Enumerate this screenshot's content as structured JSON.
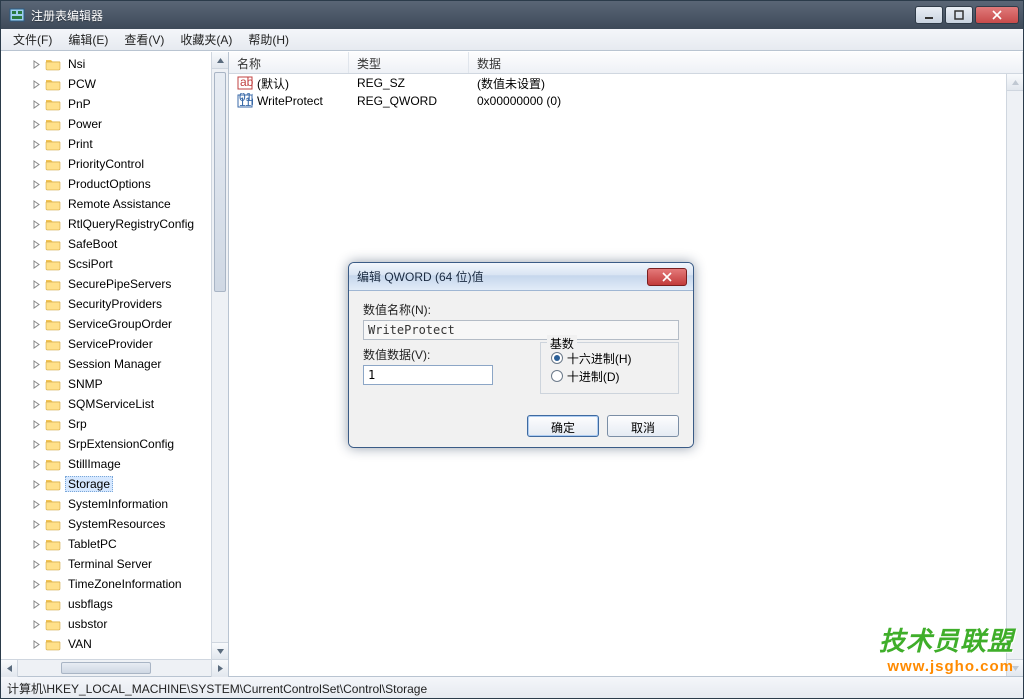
{
  "window": {
    "title": "注册表编辑器"
  },
  "menubar": [
    "文件(F)",
    "编辑(E)",
    "查看(V)",
    "收藏夹(A)",
    "帮助(H)"
  ],
  "tree": {
    "selected_index": 21,
    "items": [
      "Nsi",
      "PCW",
      "PnP",
      "Power",
      "Print",
      "PriorityControl",
      "ProductOptions",
      "Remote Assistance",
      "RtlQueryRegistryConfig",
      "SafeBoot",
      "ScsiPort",
      "SecurePipeServers",
      "SecurityProviders",
      "ServiceGroupOrder",
      "ServiceProvider",
      "Session Manager",
      "SNMP",
      "SQMServiceList",
      "Srp",
      "SrpExtensionConfig",
      "StillImage",
      "Storage",
      "SystemInformation",
      "SystemResources",
      "TabletPC",
      "Terminal Server",
      "TimeZoneInformation",
      "usbflags",
      "usbstor",
      "VAN"
    ]
  },
  "list": {
    "headers": {
      "name": "名称",
      "type": "类型",
      "data": "数据"
    },
    "rows": [
      {
        "icon": "string",
        "name": "(默认)",
        "type": "REG_SZ",
        "data": "(数值未设置)"
      },
      {
        "icon": "binary",
        "name": "WriteProtect",
        "type": "REG_QWORD",
        "data": "0x00000000 (0)"
      }
    ]
  },
  "statusbar": "计算机\\HKEY_LOCAL_MACHINE\\SYSTEM\\CurrentControlSet\\Control\\Storage",
  "dialog": {
    "title": "编辑 QWORD (64 位)值",
    "name_label": "数值名称(N):",
    "name_value": "WriteProtect",
    "data_label": "数值数据(V):",
    "data_value": "1",
    "base_label": "基数",
    "radio_hex": "十六进制(H)",
    "radio_dec": "十进制(D)",
    "ok": "确定",
    "cancel": "取消"
  },
  "watermark": {
    "line1": "技术员联盟",
    "line2": "www.jsgho.com"
  }
}
